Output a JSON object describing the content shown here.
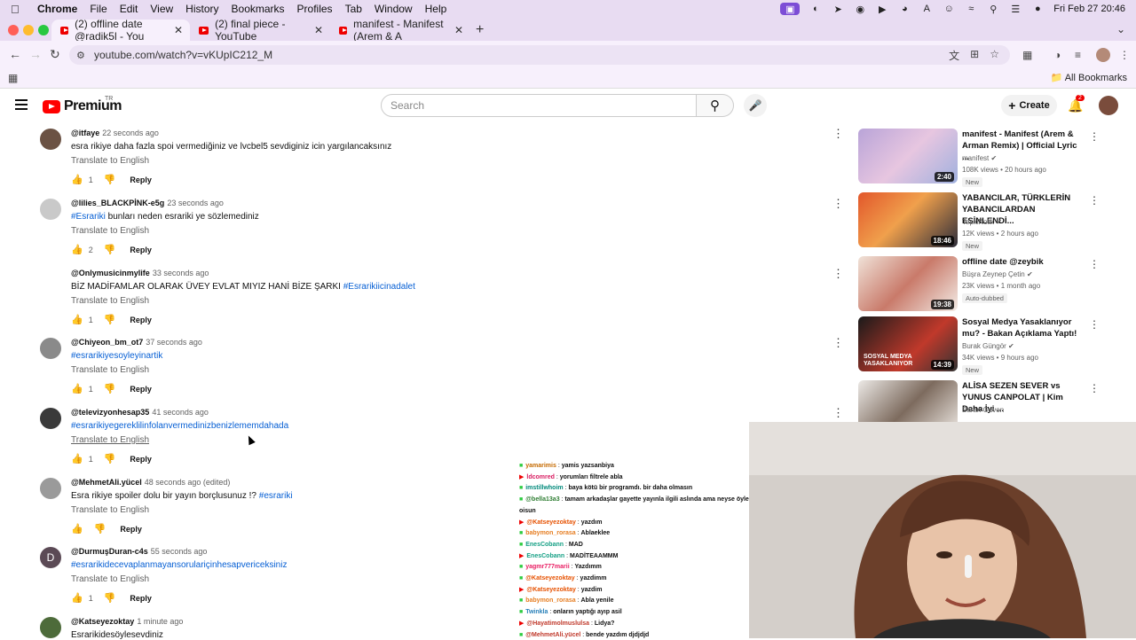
{
  "macos_menu": {
    "app": "Chrome",
    "items": [
      "File",
      "Edit",
      "View",
      "History",
      "Bookmarks",
      "Profiles",
      "Tab",
      "Window",
      "Help"
    ],
    "clock": "Fri Feb 27  20:46"
  },
  "tabs": [
    {
      "title": "(2) offline date @radik5l - You",
      "active": true
    },
    {
      "title": "(2) final piece - YouTube",
      "active": false
    },
    {
      "title": "manifest - Manifest (Arem & A",
      "active": false
    }
  ],
  "address_bar": {
    "url": "youtube.com/watch?v=vKUpIC212_M"
  },
  "bookmarks": {
    "all_label": "All Bookmarks"
  },
  "youtube_header": {
    "logo_text": "Premium",
    "region": "TR",
    "search_placeholder": "Search",
    "create_label": "Create",
    "notification_count": "2"
  },
  "comments": [
    {
      "author": "@itfaye",
      "time": "22 seconds ago",
      "text": "esra rikiye daha fazla spoi vermediğiniz ve lvcbel5 sevdiginiz icin yargılancaksınız",
      "tag": "",
      "translate": "Translate to English",
      "likes": "1",
      "reply": "Reply",
      "avatar_color": "#6b5244"
    },
    {
      "author": "@lilies_BLACKPİNK-e5g",
      "time": "23 seconds ago",
      "text": " bunları neden esrariki ye sözlemediniz",
      "tag": "#Esrariki",
      "translate": "Translate to English",
      "likes": "2",
      "reply": "Reply",
      "avatar_color": "#c9c9c9"
    },
    {
      "author": "@Onlymusicinmylife",
      "time": "33 seconds ago",
      "text": "BİZ MADİFAMLAR OLARAK ÜVEY EVLAT MIYIZ HANİ BİZE ŞARKI ",
      "tag_after": "#Esrarikiicinadalet",
      "translate": "Translate to English",
      "likes": "1",
      "reply": "Reply",
      "avatar_color": "#ffffff"
    },
    {
      "author": "@Chiyeon_bm_ot7",
      "time": "37 seconds ago",
      "text": "",
      "tag": "#esrarikiyesoyleyinartik",
      "translate": "Translate to English",
      "likes": "1",
      "reply": "Reply",
      "avatar_color": "#8a8a8a"
    },
    {
      "author": "@televizyonhesap35",
      "time": "41 seconds ago",
      "text": "",
      "tag": "#esrarikiyegereklilinfolanvermedinizbenizlememdahada",
      "translate": "Translate to English",
      "likes": "1",
      "reply": "Reply",
      "avatar_color": "#3a3a3a"
    },
    {
      "author": "@MehmetAli.yücel",
      "time": "48 seconds ago (edited)",
      "text": "Esra rikiye spoiler dolu bir yayın borçlusunuz !? ",
      "tag_after": "#esrariki",
      "translate": "Translate to English",
      "likes": "",
      "reply": "Reply",
      "avatar_color": "#9a9a9a"
    },
    {
      "author": "@DurmuşDuran-c4s",
      "time": "55 seconds ago",
      "text": "",
      "tag": "#esrarikidecevaplanmayansorulariçinhesapvericeksiniz",
      "translate": "Translate to English",
      "likes": "1",
      "reply": "Reply",
      "avatar_letter": "D"
    },
    {
      "author": "@Katseyezoktay",
      "time": "1 minute ago",
      "text": "Esrarikidesöylesevdiniz",
      "tag": "",
      "translate": "",
      "likes": "",
      "reply": "",
      "avatar_color": "#4d6b3a"
    }
  ],
  "recommendations": [
    {
      "title": "manifest - Manifest (Arem & Arman Remix) | Official Lyric ...",
      "channel": "manifest",
      "meta": "108K views • 20 hours ago",
      "badge": "New",
      "duration": "2:40",
      "thumb": "linear-gradient(135deg,#b9a4d8,#e7c6e0 50%,#9fb0de)"
    },
    {
      "title": "YABANCILAR, TÜRKLERİN YABANCILARDAN ESİNLENDİ...",
      "channel": "TepkiKolik",
      "meta": "12K views • 2 hours ago",
      "badge": "New",
      "duration": "18:46",
      "thumb": "linear-gradient(135deg,#e2572b,#f0a04c 45%,#2c2c3a)"
    },
    {
      "title": "offline date @zeybik",
      "channel": "Büşra Zeynep Çetin",
      "meta": "23K views • 1 month ago",
      "badge": "Auto-dubbed",
      "duration": "19:38",
      "thumb": "linear-gradient(135deg,#f0e2d8,#c97a6a 50%,#f3ece6)"
    },
    {
      "title": "Sosyal Medya Yasaklanıyor mu? - Bakan Açıklama Yaptı!",
      "channel": "Burak Güngör",
      "meta": "34K views • 9 hours ago",
      "badge": "New",
      "duration": "14:39",
      "overlay": "SOSYAL MEDYA YASAKLANIYOR",
      "thumb": "linear-gradient(135deg,#1a1a1a,#c0392b 60%,#333)"
    },
    {
      "title": "ALİSA SEZEN SEVER vs YUNUS CANPOLAT | Kim Daha İyi ...",
      "channel": "Baran Guven",
      "meta": "",
      "badge": "",
      "duration": "",
      "thumb": "linear-gradient(135deg,#ece9e6,#7d6b5e 50%,#f0ebe6)"
    }
  ],
  "chat": [
    {
      "user": "yamarimis",
      "msg": "yamis yazsanbiya",
      "color": "#c56a00"
    },
    {
      "user": "ldcomred",
      "msg": "yorumları filtrele abla",
      "color": "#d81b60"
    },
    {
      "user": "imstillwhoim",
      "msg": "baya kötü bir programdı. bir daha olmasın",
      "color": "#00897b"
    },
    {
      "user": "@bella13a3",
      "msg": "tamam arkadaşlar gayette yayınla ilgili aslında ama neyse öyle",
      "color": "#2e7d32",
      "cont": "oisun"
    },
    {
      "user": "@Katseyezoktay",
      "msg": "yazdım",
      "color": "#e65100"
    },
    {
      "user": "babymon_rorasa",
      "msg": "Ablaeklee",
      "color": "#e67e22"
    },
    {
      "user": "EnesCobann",
      "msg": "MAD",
      "color": "#16a085"
    },
    {
      "user": "EnesCobann",
      "msg": "MADİTEAAMMM",
      "color": "#16a085"
    },
    {
      "user": "yagmr777marii",
      "msg": "Yazdımm",
      "color": "#e91e63"
    },
    {
      "user": "@Katseyezoktay",
      "msg": "yazdimm",
      "color": "#e65100"
    },
    {
      "user": "@Katseyezoktay",
      "msg": "yazdim",
      "color": "#e65100"
    },
    {
      "user": "babymon_rorasa",
      "msg": "Abla yenile",
      "color": "#e67e22"
    },
    {
      "user": "Twinkla",
      "msg": "onların yaptığı ayıp asil",
      "color": "#2980b9"
    },
    {
      "user": "@Hayatimolmuslulsa",
      "msg": "Lidya?",
      "color": "#c0392b"
    },
    {
      "user": "@MehmetAli.yücel",
      "msg": "bende yazdım djdjdjd",
      "color": "#c0392b"
    }
  ]
}
